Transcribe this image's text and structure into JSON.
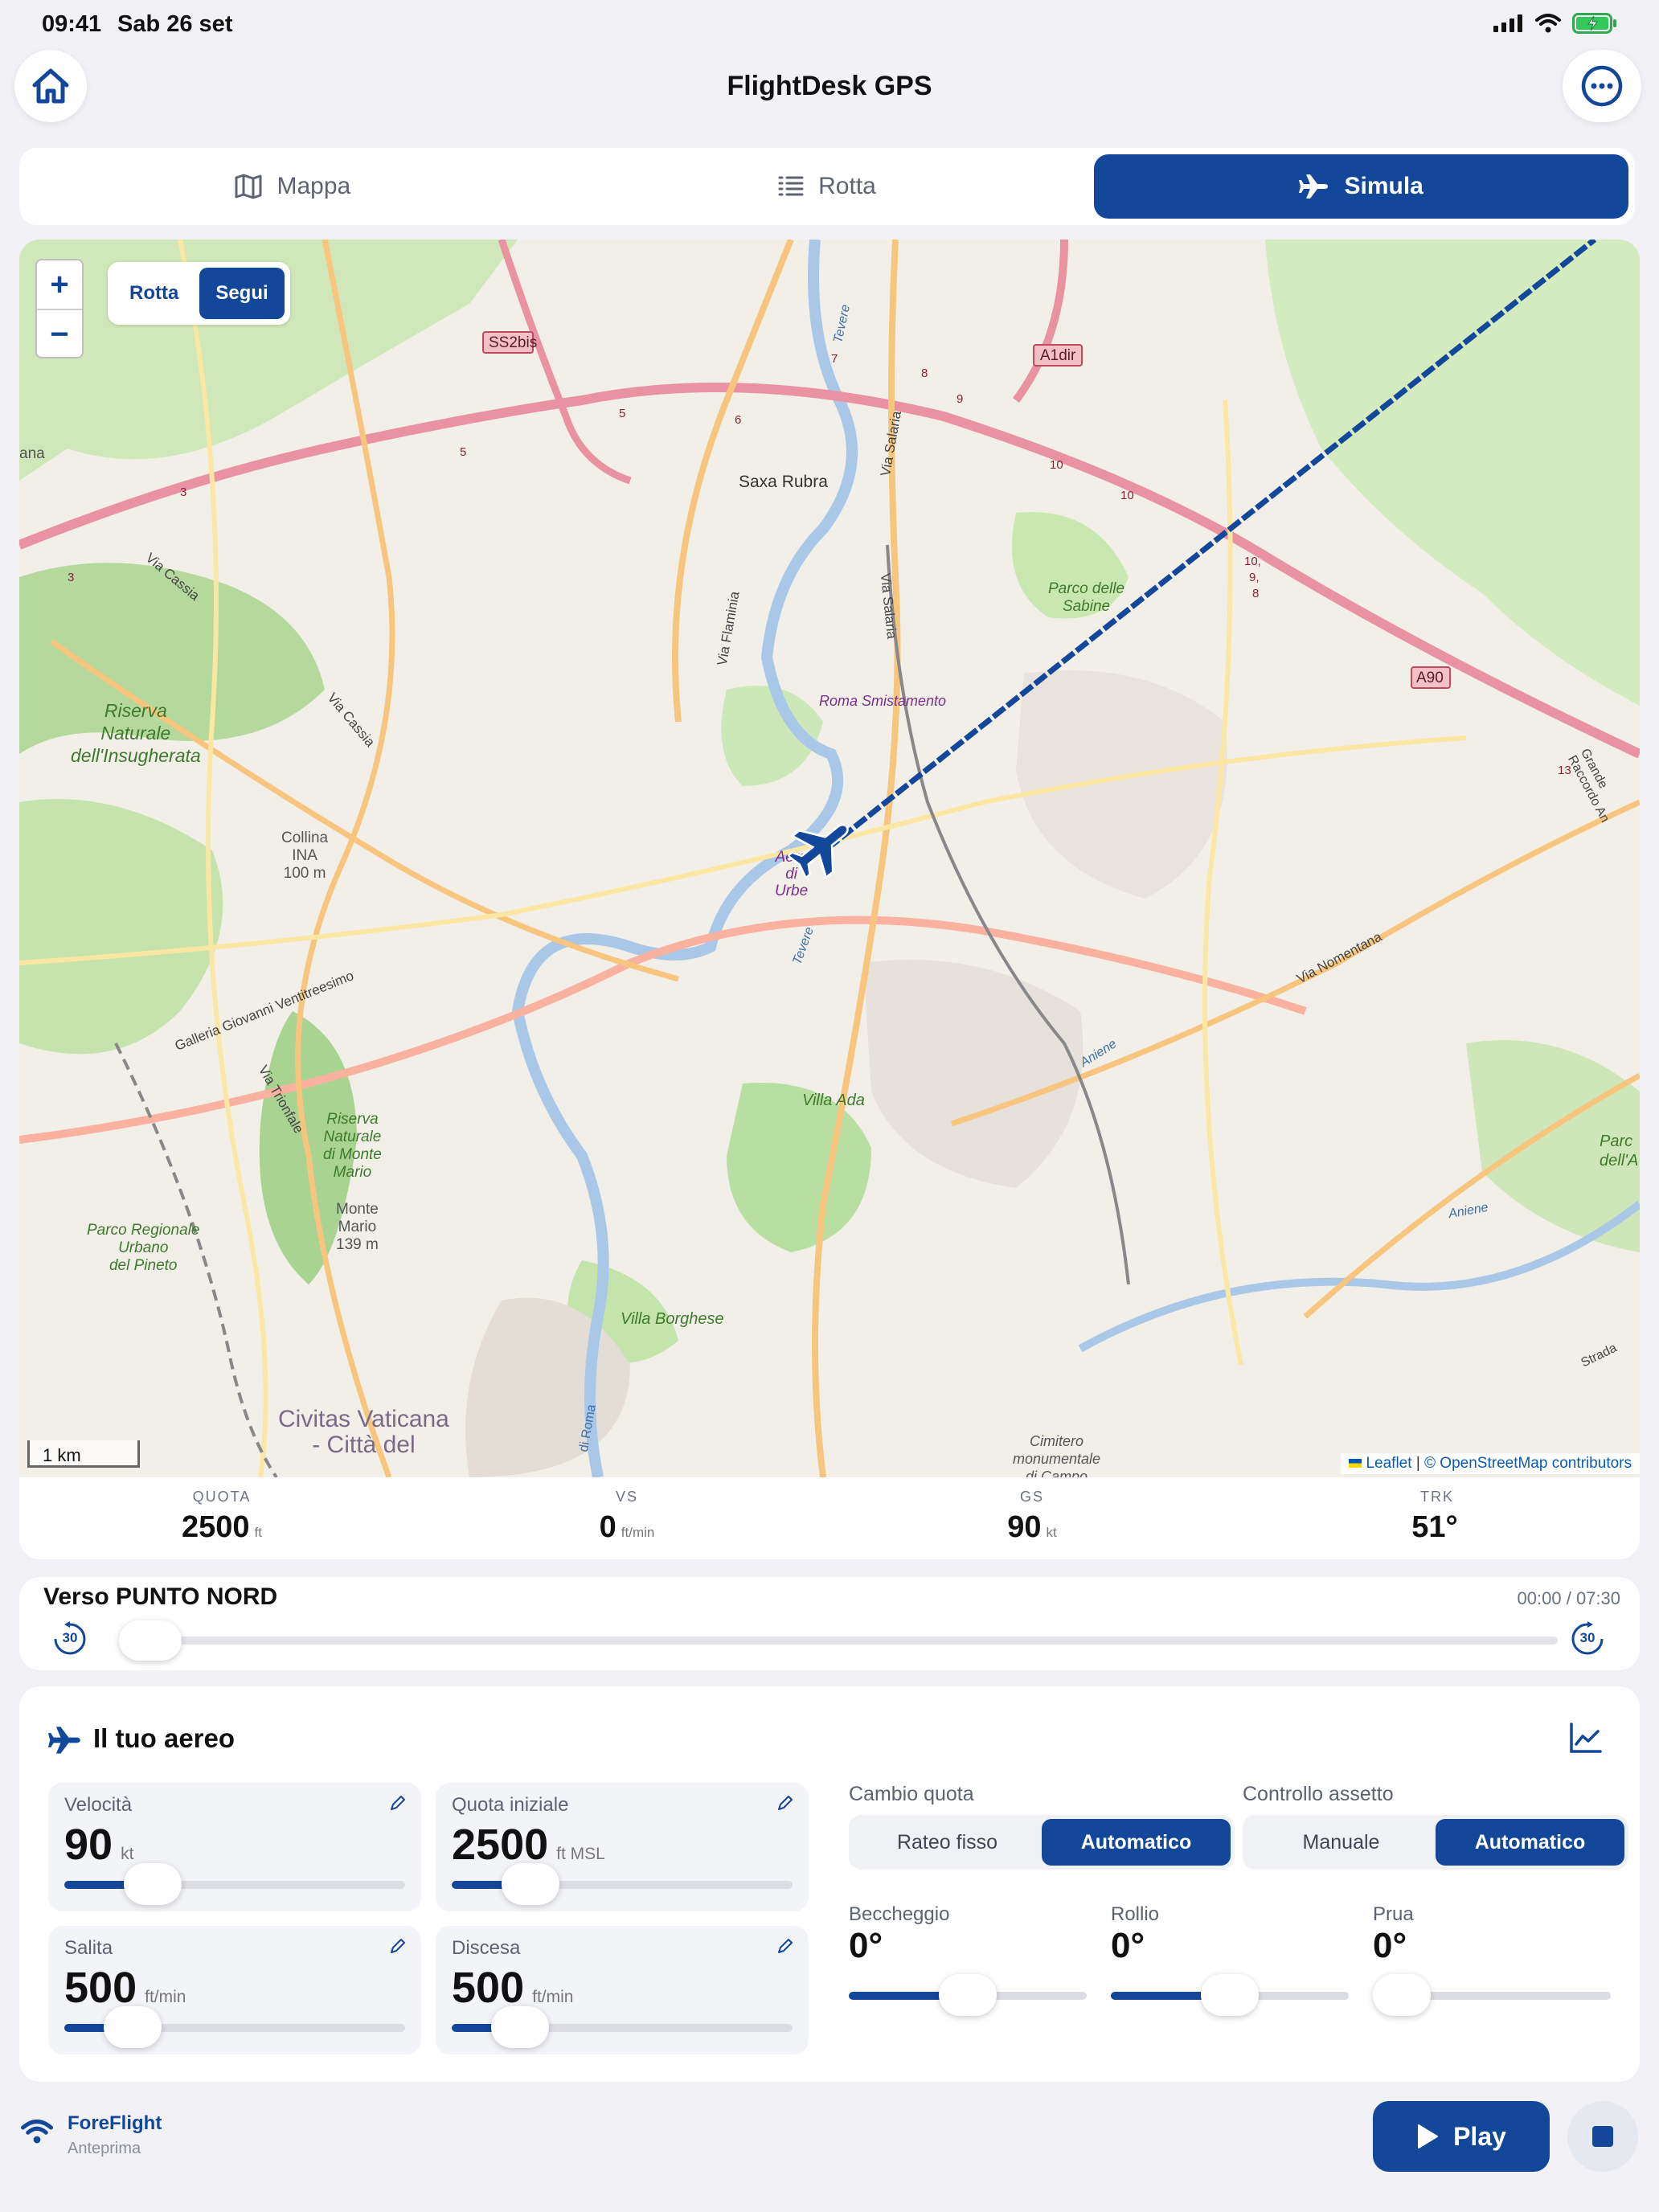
{
  "status_bar": {
    "time": "09:41",
    "date": "Sab 26 set"
  },
  "header": {
    "title": "FlightDesk GPS",
    "home_icon": "home-icon",
    "more_icon": "ellipsis-icon"
  },
  "tabs": [
    {
      "label": "Mappa",
      "icon": "map-icon",
      "active": false
    },
    {
      "label": "Rotta",
      "icon": "list-icon",
      "active": false
    },
    {
      "label": "Simula",
      "icon": "airplane-icon",
      "active": true
    }
  ],
  "map": {
    "zoom_in": "+",
    "zoom_out": "−",
    "mode_options": [
      "Rotta",
      "Segui"
    ],
    "mode_selected": "Segui",
    "scale": "1 km",
    "attribution_leaflet": "Leaflet",
    "attribution_osm": "© OpenStreetMap contributors",
    "labels": {
      "ss2bis": "SS2bis",
      "a1dir": "A1dir",
      "a90": "A90",
      "saxa": "Saxa Rubra",
      "sabine1": "Parco delle",
      "sabine2": "Sabine",
      "smist": "Roma Smistamento",
      "ins1": "Riserva",
      "ins2": "Naturale",
      "ins3": "dell'Insugherata",
      "collina1": "Collina",
      "collina2": "INA",
      "collina3": "100 m",
      "aero1": "Aero",
      "aero2": "di",
      "aero3": "Urbe",
      "ada": "Villa Ada",
      "borghese": "Villa Borghese",
      "mm1": "Riserva",
      "mm2": "Naturale",
      "mm3": "di Monte",
      "mm4": "Mario",
      "mario1": "Monte",
      "mario2": "Mario",
      "mario3": "139 m",
      "pineto1": "Parco Regionale",
      "pineto2": "Urbano",
      "pineto3": "del Pineto",
      "vatican1": "Civitas Vaticana",
      "vatican2": "- Città del",
      "cimitero1": "Cimitero",
      "cimitero2": "monumentale",
      "cimitero3": "di Campo",
      "cassia": "Via Cassia",
      "cassia2": "Via Cassia",
      "flaminia": "Via Flaminia",
      "salaria": "Via Salaria",
      "salaria2": "Via Salaria",
      "nomentana": "Via Nomentana",
      "trionfale": "Via Trionfale",
      "ventitre": "Galleria Giovanni Ventitreesimo",
      "tevere1": "Tevere",
      "tevere2": "Tevere",
      "aniene1": "Aniene",
      "aniene2": "Aniene",
      "gra": "Grande Raccordo An",
      "strada": "Strada",
      "parco_edge1": "Parc",
      "parco_edge2": "dell'A",
      "ana": "ana",
      "roma_road": "di Roma",
      "n3a": "3",
      "n3b": "3",
      "n5a": "5",
      "n5b": "5",
      "n6": "6",
      "n7": "7",
      "n8": "8",
      "n9": "9",
      "n10a": "10",
      "n10b": "10",
      "n10c": "10,",
      "n9b": "9,",
      "n8b": "8",
      "n13": "13"
    }
  },
  "stats": [
    {
      "label": "QUOTA",
      "value": "2500",
      "unit": "ft"
    },
    {
      "label": "VS",
      "value": "0",
      "unit": "ft/min"
    },
    {
      "label": "GS",
      "value": "90",
      "unit": "kt"
    },
    {
      "label": "TRK",
      "value": "51°",
      "unit": ""
    }
  ],
  "route": {
    "title": "Verso PUNTO NORD",
    "time": "00:00 / 07:30",
    "skip_back": "30",
    "skip_forward": "30",
    "progress": 0
  },
  "aircraft": {
    "title": "Il tuo aereo",
    "params": [
      {
        "label": "Velocità",
        "value": "90",
        "unit": "kt",
        "fraction": 0.26
      },
      {
        "label": "Quota iniziale",
        "value": "2500",
        "unit": "ft MSL",
        "fraction": 0.23
      },
      {
        "label": "Salita",
        "value": "500",
        "unit": "ft/min",
        "fraction": 0.2
      },
      {
        "label": "Discesa",
        "value": "500",
        "unit": "ft/min",
        "fraction": 0.2
      }
    ],
    "altitude_change": {
      "label": "Cambio quota",
      "options": [
        "Rateo fisso",
        "Automatico"
      ],
      "selected": "Automatico"
    },
    "attitude_control": {
      "label": "Controllo assetto",
      "options": [
        "Manuale",
        "Automatico"
      ],
      "selected": "Automatico"
    },
    "attitude": [
      {
        "label": "Beccheggio",
        "value": "0°",
        "fraction": 0.5
      },
      {
        "label": "Rollio",
        "value": "0°",
        "fraction": 0.5
      },
      {
        "label": "Prua",
        "value": "0°",
        "fraction": 0.0
      }
    ]
  },
  "footer": {
    "connection_title": "ForeFlight",
    "connection_subtitle": "Anteprima",
    "play_label": "Play"
  },
  "colors": {
    "accent": "#13479a",
    "background": "#f1f1f6"
  }
}
